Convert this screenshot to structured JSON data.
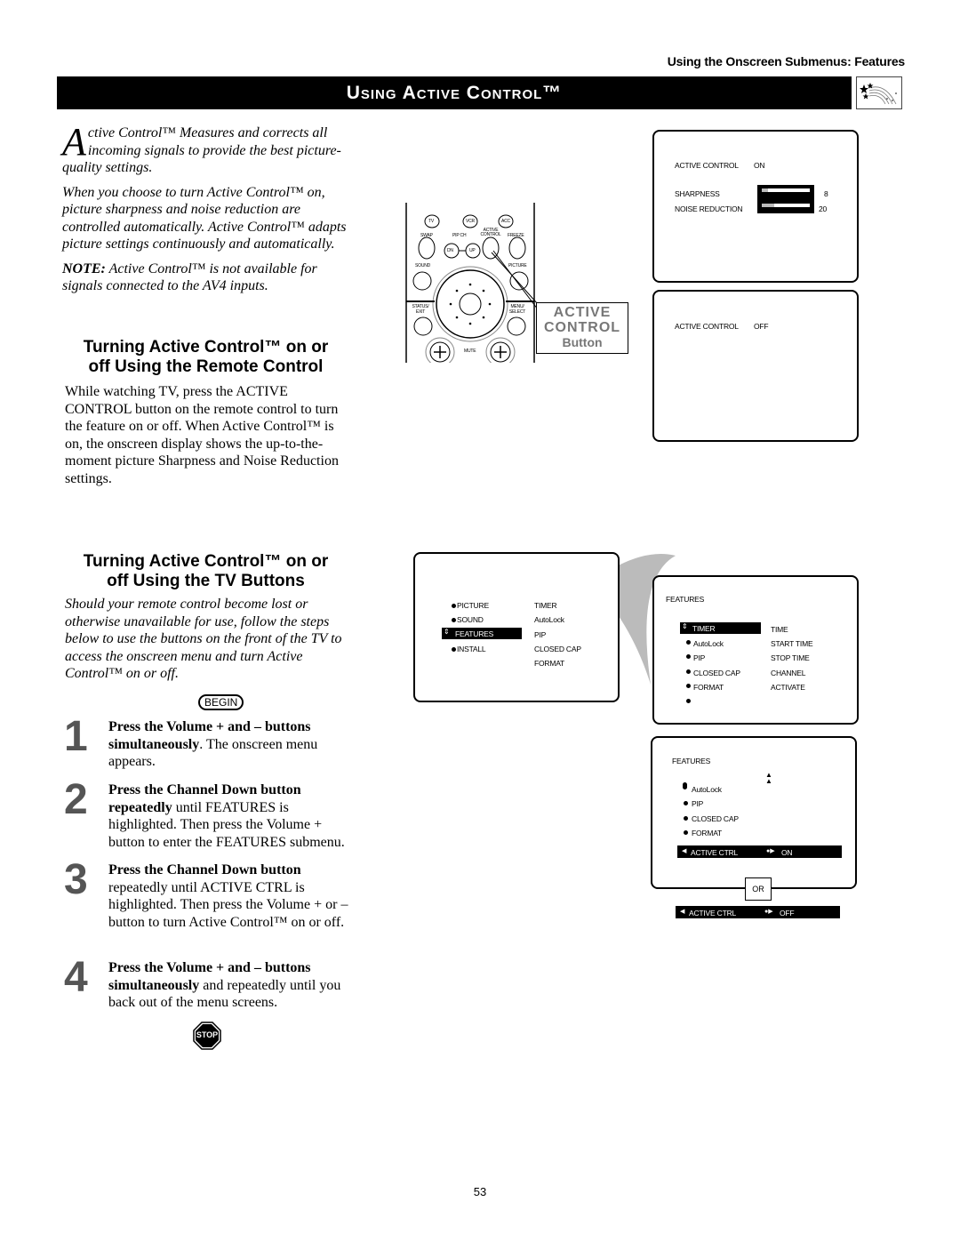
{
  "header": {
    "running_head": "Using the Onscreen Submenus: Features",
    "title": "Using Active Control™",
    "title_icon": "shooting-stars-icon"
  },
  "intro": {
    "dropcap": "A",
    "para1_rest": "ctive Control™ Measures and corrects all incoming signals to provide the best picture-quality settings.",
    "para2": "When you choose to turn Active Control™ on, picture sharpness and noise reduction are controlled automatically. Active Control™ adapts picture settings continuously and automatically.",
    "note_label": "NOTE:",
    "note_text": " Active Control™ is not available for signals connected to the AV4 inputs."
  },
  "remote_section": {
    "heading_line1": "Turning Active Control™ on or",
    "heading_line2": "off Using the Remote Control",
    "body": "While watching TV, press the ACTIVE CONTROL button on the remote control to turn the feature on or off. When Active Control™ is on, the onscreen display shows the up-to-the-moment picture Sharpness and Noise Reduction settings."
  },
  "remote_illustration": {
    "buttons": {
      "tv": "TV",
      "vcr": "VCR",
      "acc": "ACC",
      "swap": "SWAP",
      "pip_ch": "PIP CH",
      "active_control": "ACTIVE CONTROL",
      "freeze": "FREEZE",
      "dn": "DN",
      "up": "UP",
      "sound": "SOUND",
      "picture": "PICTURE",
      "status_exit": "STATUS/ EXIT",
      "menu_select": "MENU/ SELECT",
      "mute": "MUTE"
    },
    "callout_line1": "ACTIVE",
    "callout_line2": "CONTROL",
    "callout_line3": "Button"
  },
  "osd_on": {
    "label": "ACTIVE  CONTROL",
    "state": "ON",
    "sharpness_label": "SHARPNESS",
    "sharpness_value": "8",
    "sharpness_fraction": 0.13,
    "noise_label": "NOISE  REDUCTION",
    "noise_value": "20",
    "noise_fraction": 0.25
  },
  "osd_off": {
    "label": "ACTIVE  CONTROL",
    "state": "OFF"
  },
  "tv_section": {
    "heading_line1": "Turning Active Control™ on or",
    "heading_line2": "off Using the TV Buttons",
    "intro": "Should your remote control become lost or otherwise unavailable for use, follow the steps below to use the buttons on the front of the TV to access the onscreen menu and turn Active Control™ on or off.",
    "begin_label": "BEGIN",
    "stop_label": "STOP",
    "steps": [
      {
        "num": "1",
        "bold": "Press the Volume + and – buttons simultaneously",
        "text": ". The onscreen menu appears."
      },
      {
        "num": "2",
        "bold": "Press the Channel Down button repeatedly",
        "text": " until FEATURES is highlighted. Then press the Volume + button to enter the FEATURES submenu."
      },
      {
        "num": "3",
        "bold": "Press the Channel Down button",
        "text": " repeatedly until ACTIVE CTRL is highlighted. Then press the Volume + or – button to turn Active Control™ on or off."
      },
      {
        "num": "4",
        "bold": "Press the Volume + and – buttons simultaneously",
        "text": " and repeatedly until you back out of the menu screens."
      }
    ]
  },
  "osd_main_menu": {
    "left_items": [
      "PICTURE",
      "SOUND",
      "FEATURES",
      "INSTALL"
    ],
    "selected": "FEATURES",
    "right_items": [
      "TIMER",
      "AutoLock",
      "PIP",
      "CLOSED  CAP",
      "FORMAT"
    ]
  },
  "osd_features_menu": {
    "title": "FEATURES",
    "left_items": [
      "TIMER",
      "AutoLock",
      "PIP",
      "CLOSED  CAP",
      "FORMAT"
    ],
    "selected": "TIMER",
    "right_items": [
      "TIME",
      "START  TIME",
      "STOP  TIME",
      "CHANNEL",
      "ACTIVATE"
    ]
  },
  "osd_active_ctrl": {
    "title": "FEATURES",
    "items": [
      "AutoLock",
      "PIP",
      "CLOSED  CAP",
      "FORMAT"
    ],
    "active_label": "ACTIVE  CTRL",
    "on_value": "ON",
    "or_label": "OR",
    "off_value": "OFF"
  },
  "footer": {
    "page_number": "53"
  }
}
